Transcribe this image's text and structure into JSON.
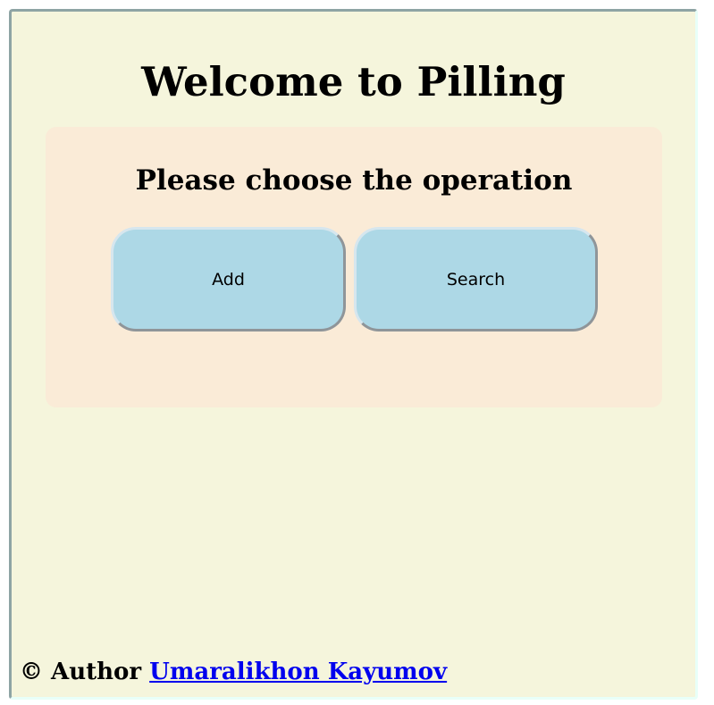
{
  "page": {
    "title": "Welcome to Pilling"
  },
  "panel": {
    "heading": "Please choose the operation",
    "buttons": {
      "add_label": "Add",
      "search_label": "Search"
    }
  },
  "footer": {
    "prefix": "© Author",
    "author_link": "Umaralikhon Kayumov"
  },
  "colors": {
    "page_background": "#f5f5dc",
    "panel_background": "#faebd7",
    "button_background": "#add8e6",
    "link": "#0000ee"
  }
}
